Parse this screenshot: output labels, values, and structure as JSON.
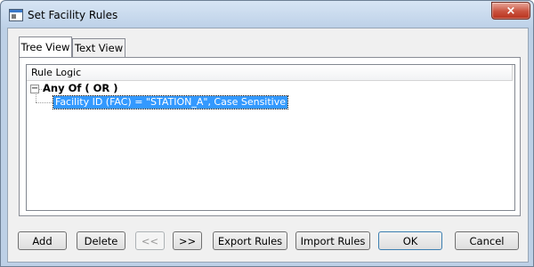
{
  "window": {
    "title": "Set Facility Rules",
    "close_label": "×"
  },
  "tabs": [
    {
      "label": "Tree View",
      "active": true
    },
    {
      "label": "Text View",
      "active": false
    }
  ],
  "tree": {
    "column_header": "Rule Logic",
    "expander_glyph": "−",
    "root": {
      "label": "Any Of  ( OR )",
      "expanded": true,
      "children": [
        {
          "label": "Facility ID (FAC) = \"STATION_A\", Case Sensitive",
          "selected": true
        }
      ]
    }
  },
  "buttons": {
    "add": "Add",
    "delete": "Delete",
    "prev": "<<",
    "next": ">>",
    "export": "Export Rules",
    "import": "Import Rules",
    "ok": "OK",
    "cancel": "Cancel"
  },
  "colors": {
    "selection": "#3399ff",
    "close_button": "#c9523e",
    "title_bar": "#bdd1e8"
  }
}
